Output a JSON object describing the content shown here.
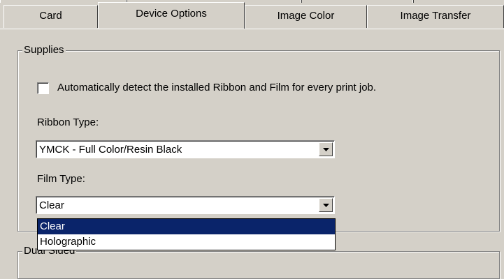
{
  "tabs": [
    {
      "label": "Card"
    },
    {
      "label": "Device Options"
    },
    {
      "label": "Image Color"
    },
    {
      "label": "Image Transfer"
    }
  ],
  "supplies": {
    "legend": "Supplies",
    "auto_detect": {
      "label": "Automatically detect the installed Ribbon and Film for every print job.",
      "checked": false
    },
    "ribbon_type": {
      "label": "Ribbon Type:",
      "value": "YMCK - Full Color/Resin Black"
    },
    "film_type": {
      "label": "Film Type:",
      "value": "Clear",
      "options": [
        "Clear",
        "Holographic"
      ],
      "highlighted": "Clear"
    }
  },
  "dual_sided": {
    "legend": "Dual Sided"
  },
  "colors": {
    "face": "#d4d0c8",
    "selection": "#0a246a",
    "selection_text": "#ffffff"
  }
}
